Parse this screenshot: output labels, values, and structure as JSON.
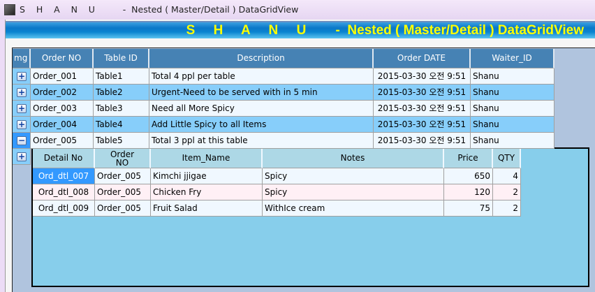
{
  "window": {
    "title": "S    H    A    N    U          -  Nested ( Master/Detail ) DataGridView"
  },
  "banner": {
    "text": "S     H     A     N     U        -  Nested ( Master/Detail ) DataGridView"
  },
  "colors": {
    "header": "#4682b4",
    "row_alt": "#87cefa",
    "row": "#f0f8ff",
    "selected": "#3399ff",
    "detail_bg": "#87ceeb",
    "detail_header": "#add8e6",
    "detail_alt": "#fff0f5",
    "banner_text": "#ffff00"
  },
  "master": {
    "columns": [
      "mg",
      "Order NO",
      "Table ID",
      "Description",
      "Order DATE",
      "Waiter_ID"
    ],
    "rows": [
      {
        "expander": "+",
        "order_no": "Order_001",
        "table_id": "Table1",
        "description": "Total 4 ppl per table",
        "date": "2015-03-30 오전 9:51",
        "waiter": "Shanu"
      },
      {
        "expander": "+",
        "order_no": "Order_002",
        "table_id": "Table2",
        "description": "Urgent-Need to be served with in 5 min",
        "date": "2015-03-30 오전 9:51",
        "waiter": "Shanu"
      },
      {
        "expander": "+",
        "order_no": "Order_003",
        "table_id": "Table3",
        "description": "Need all More Spicy",
        "date": "2015-03-30 오전 9:51",
        "waiter": "Shanu"
      },
      {
        "expander": "+",
        "order_no": "Order_004",
        "table_id": "Table4",
        "description": "Add Little Spicy to all Items",
        "date": "2015-03-30 오전 9:51",
        "waiter": "Shanu"
      },
      {
        "expander": "−",
        "order_no": "Order_005",
        "table_id": "Table5",
        "description": "Total 3 ppl at this table",
        "date": "2015-03-30 오전 9:51",
        "waiter": "Shanu"
      }
    ],
    "extra_expander": "+"
  },
  "detail": {
    "columns": [
      "Detail No",
      "Order NO",
      "Item_Name",
      "Notes",
      "Price",
      "QTY"
    ],
    "rows": [
      {
        "detail_no": "Ord_dtl_007",
        "order_no": "Order_005",
        "item": "Kimchi jjigae",
        "notes": "Spicy",
        "price": "650",
        "qty": "4"
      },
      {
        "detail_no": "Ord_dtl_008",
        "order_no": "Order_005",
        "item": "Chicken Fry",
        "notes": "Spicy",
        "price": "120",
        "qty": "2"
      },
      {
        "detail_no": "Ord_dtl_009",
        "order_no": "Order_005",
        "item": "Fruit Salad",
        "notes": "WithIce cream",
        "price": "75",
        "qty": "2"
      }
    ]
  }
}
